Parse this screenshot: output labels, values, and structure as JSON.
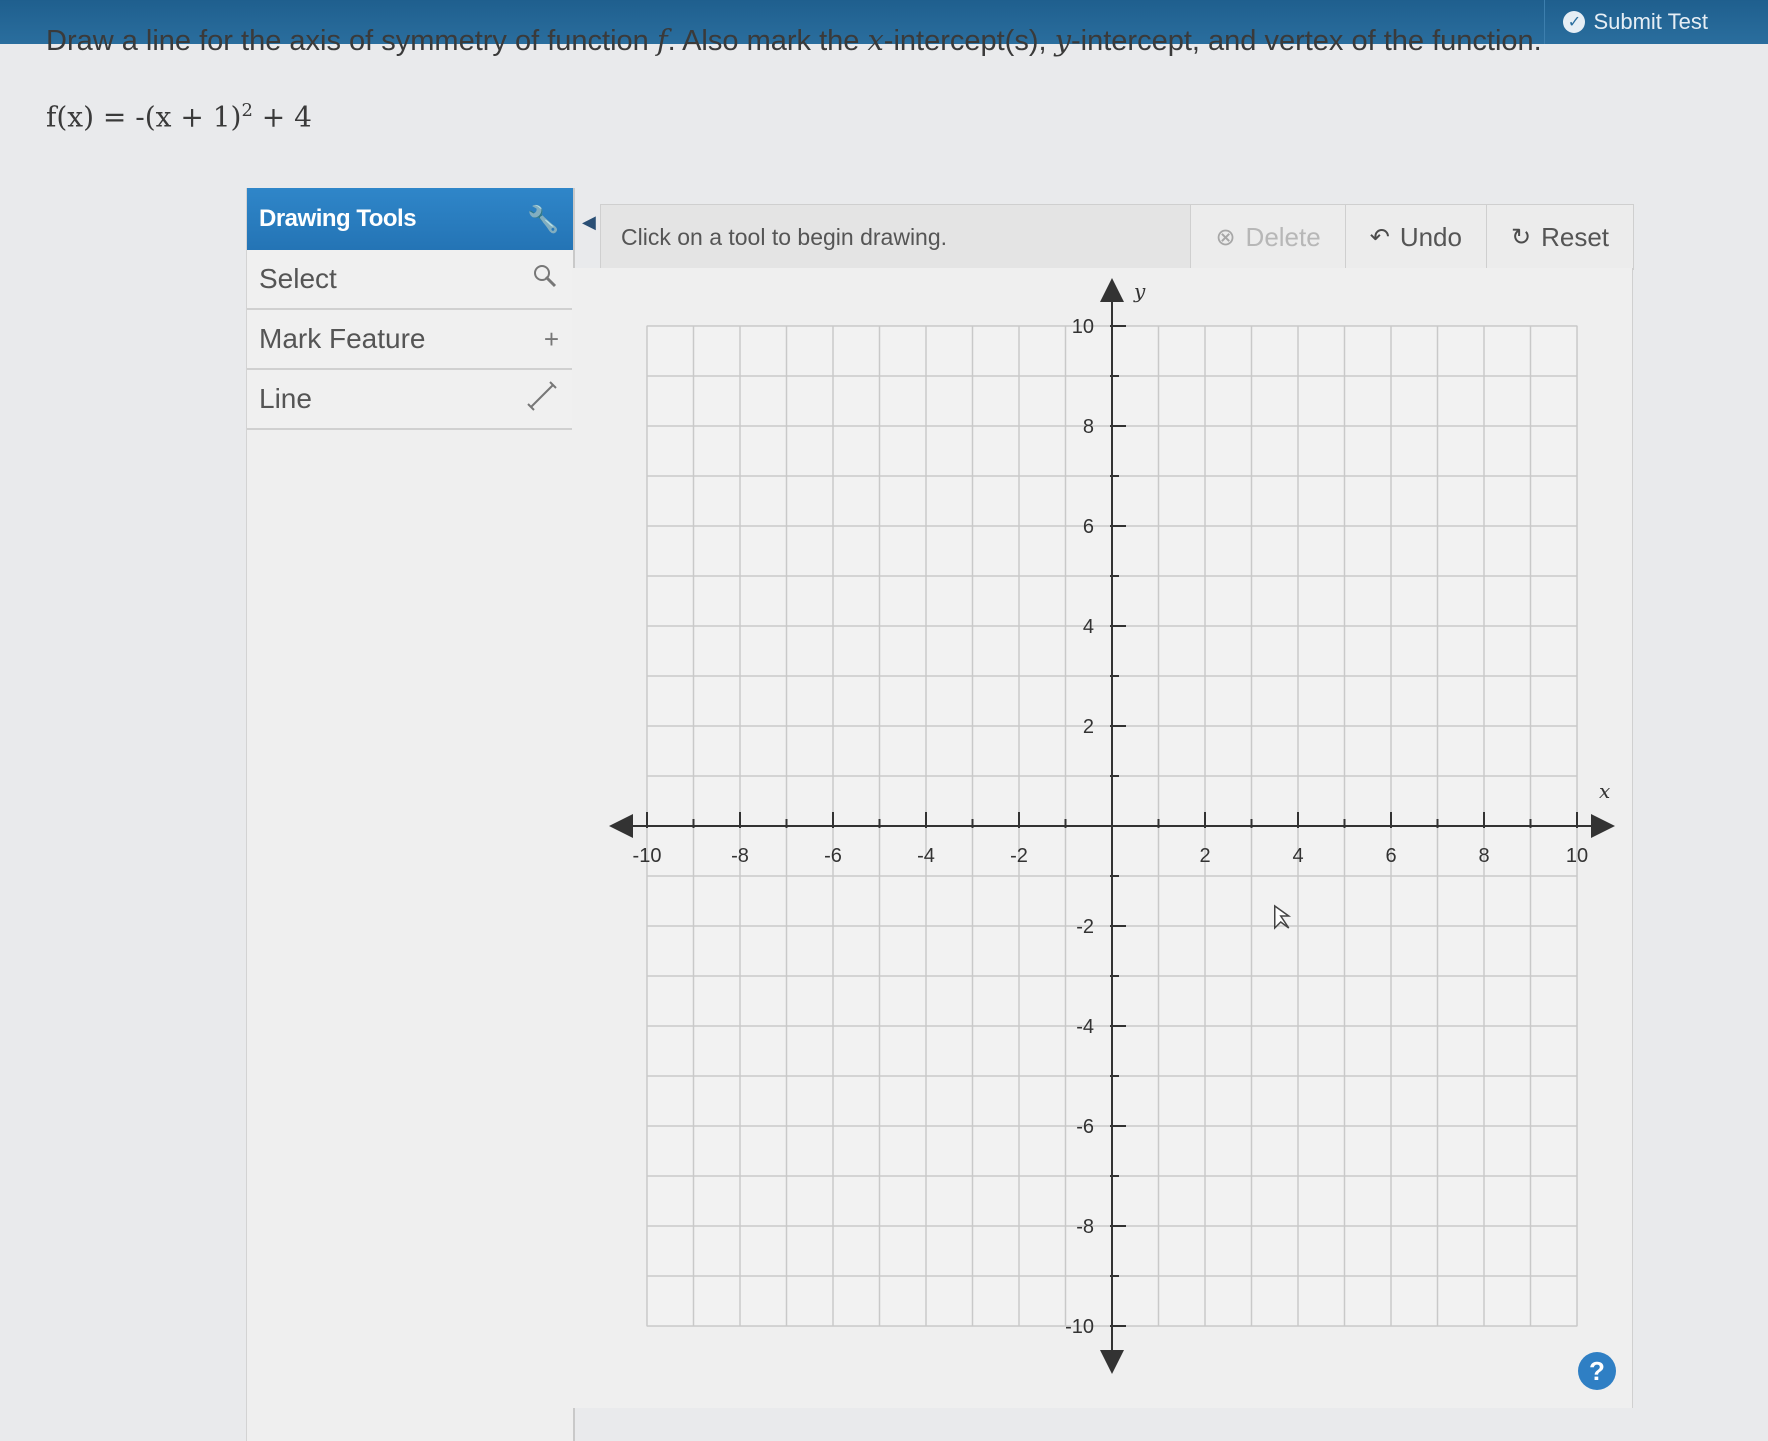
{
  "header": {
    "submit_label": "Submit Test"
  },
  "question": {
    "text_1": "Draw a line for the axis of symmetry of function ",
    "fname": "f",
    "text_2": ". Also mark the ",
    "xvar": "x",
    "text_3": "-intercept(s), ",
    "yvar": "y",
    "text_4": "-intercept, and vertex of the function.",
    "formula_lhs": "f(x) = -(x + 1)",
    "formula_exp": "2",
    "formula_rhs": " + 4"
  },
  "tools": {
    "header_label": "Drawing Tools",
    "items": [
      {
        "label": "Select",
        "icon": "pointer-icon"
      },
      {
        "label": "Mark Feature",
        "icon": "plus-icon"
      },
      {
        "label": "Line",
        "icon": "line-icon"
      }
    ]
  },
  "toolbar": {
    "hint": "Click on a tool to begin drawing.",
    "delete_label": "Delete",
    "undo_label": "Undo",
    "reset_label": "Reset"
  },
  "colors": {
    "accent": "#2f86c9",
    "grid": "#c9c9c9",
    "axis": "#333333"
  },
  "chart_data": {
    "type": "scatter",
    "xlabel": "x",
    "ylabel": "y",
    "xlim": [
      -10,
      10
    ],
    "ylim": [
      -10,
      10
    ],
    "grid": true,
    "x_ticks": [
      -10,
      -8,
      -6,
      -4,
      -2,
      2,
      4,
      6,
      8,
      10
    ],
    "y_ticks": [
      10,
      8,
      6,
      4,
      2,
      -2,
      -4,
      -6,
      -8,
      -10
    ],
    "series": []
  }
}
